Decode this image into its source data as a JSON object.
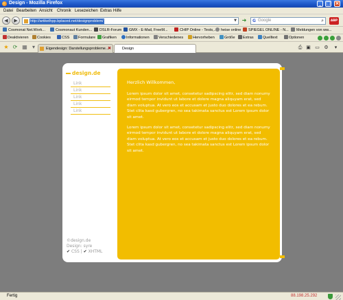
{
  "window": {
    "title": "Design - Mozilla Firefox"
  },
  "menu": [
    "Datei",
    "Bearbeiten",
    "Ansicht",
    "Chronik",
    "Lesezeichen",
    "Extras",
    "Hilfe"
  ],
  "nav": {
    "url": "http://artikelhpp.bplaced.net/designproblem/",
    "search_placeholder": "Google"
  },
  "bookmarks": [
    "Cosmonat Net.Work...",
    "Cosmonaut Kunden...",
    "DSLR-Forum",
    "GMX - E-Mail, FreeM...",
    "CHIP Online - Tests,...",
    "heise online",
    "SPIEGEL ONLINE - N...",
    "Meldungen von ww..."
  ],
  "devtools": [
    "Deaktivieren",
    "Cookies",
    "CSS",
    "Formulare",
    "Grafiken",
    "Informationen",
    "Verschiedenes",
    "Hervorheben",
    "Größe",
    "Extras",
    "Quelltext",
    "Optionen"
  ],
  "tabs": [
    {
      "label": "Eigendesign: Darstellungsprobleme...",
      "active": false
    },
    {
      "label": "Design",
      "active": true
    }
  ],
  "page": {
    "logo": "design.de",
    "links": [
      "Link",
      "Link",
      "Link",
      "Link",
      "Link"
    ],
    "heading": "Herzlich Willkommen,",
    "paragraphs": [
      "Lorem ipsum dolor sit amet, consetetur sadipscing elitr, sed diam nonumy eirmod tempor invidunt ut labore et dolore magna aliquyam erat, sed diam voluptua. At vero eos et accusam et justo duo dolores et ea rebum. Stet clita kasd gubergren, no sea takimata sanctus est Lorem ipsum dolor sit amet.",
      "Lorem ipsum dolor sit amet, consetetur sadipscing elitr, sed diam nonumy eirmod tempor invidunt ut labore et dolore magna aliquyam erat, sed diam voluptua. At vero eos et accusam et justo duo dolores et ea rebum. Stet clita kasd gubergren, no sea takimata sanctus est Lorem ipsum dolor sit amet."
    ],
    "footer": {
      "copyright": "©design.de",
      "design_label": "Design: syre",
      "css": "CSS",
      "separator": "|",
      "xhtml": "XHTML"
    }
  },
  "status": {
    "text": "Fertig",
    "ip": "88.198.25.292"
  },
  "colors": {
    "accent": "#f2bd00",
    "page_bg": "#7d7d7d"
  }
}
